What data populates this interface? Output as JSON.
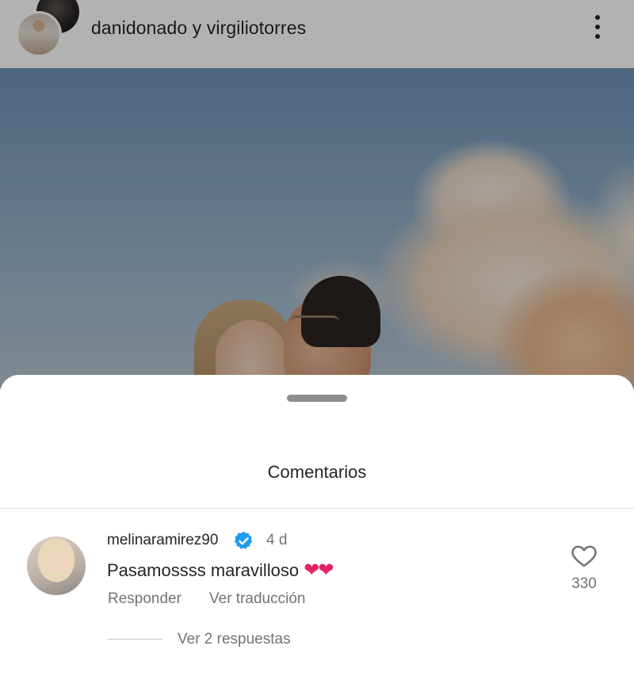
{
  "post": {
    "header_title": "danidonado y virgiliotorres",
    "icons": {
      "more": "more-vertical-icon"
    }
  },
  "comments_sheet": {
    "title": "Comentarios",
    "comments": [
      {
        "username": "melinaramirez90",
        "verified": true,
        "time": "4 d",
        "text": "Pasamossss maravilloso",
        "emoji": "❤❤",
        "reply_label": "Responder",
        "translate_label": "Ver traducción",
        "likes": "330",
        "view_replies_label": "Ver 2 respuestas"
      }
    ]
  },
  "colors": {
    "primary_text": "#262626",
    "secondary_text": "#737373",
    "verified_badge": "#1d9bf0",
    "heart_emoji": "#e0245e"
  }
}
